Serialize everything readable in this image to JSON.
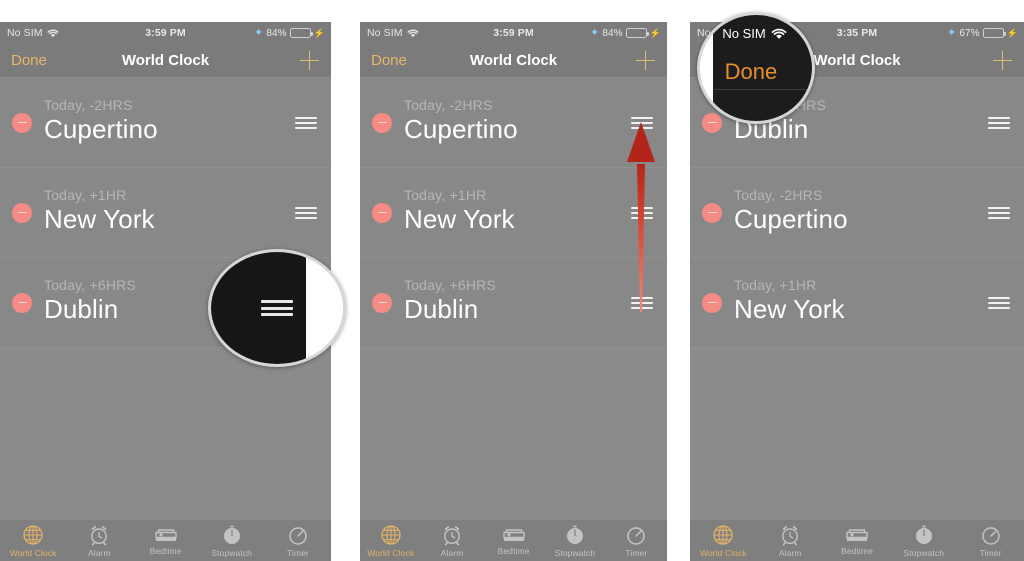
{
  "page": {
    "background": "#ffffff",
    "panel_background": "#878787",
    "accent_orange": "#e3b267",
    "delete_red": "#f58b84",
    "arrow_color": "#c0281c"
  },
  "panels": [
    {
      "id": "panel-1",
      "status_bar": {
        "carrier": "No SIM",
        "wifi_icon": "wifi-icon",
        "time": "3:59 PM",
        "bluetooth_icon": "bluetooth-icon",
        "battery_percent": "84%",
        "battery_level": 84,
        "charging_icon": "charging-bolt-icon"
      },
      "nav": {
        "done_label": "Done",
        "title": "World Clock",
        "add_icon": "plus-icon"
      },
      "rows": [
        {
          "subtitle": "Today, -2HRS",
          "city": "Cupertino",
          "delete_icon": "minus-circle-icon",
          "handle_icon": "drag-handle-icon"
        },
        {
          "subtitle": "Today, +1HR",
          "city": "New York",
          "delete_icon": "minus-circle-icon",
          "handle_icon": "drag-handle-icon"
        },
        {
          "subtitle": "Today, +6HRS",
          "city": "Dublin",
          "delete_icon": "minus-circle-icon",
          "handle_icon": "drag-handle-icon"
        }
      ],
      "tabs": [
        {
          "label": "World Clock",
          "icon": "globe-icon",
          "active": true
        },
        {
          "label": "Alarm",
          "icon": "alarm-clock-icon",
          "active": false
        },
        {
          "label": "Bedtime",
          "icon": "bed-icon",
          "active": false
        },
        {
          "label": "Stopwatch",
          "icon": "stopwatch-icon",
          "active": false
        },
        {
          "label": "Timer",
          "icon": "timer-icon",
          "active": false
        }
      ],
      "callout": {
        "type": "drag-handle-magnifier",
        "handle_icon": "drag-handle-icon"
      }
    },
    {
      "id": "panel-2",
      "status_bar": {
        "carrier": "No SIM",
        "wifi_icon": "wifi-icon",
        "time": "3:59 PM",
        "bluetooth_icon": "bluetooth-icon",
        "battery_percent": "84%",
        "battery_level": 84,
        "charging_icon": "charging-bolt-icon"
      },
      "nav": {
        "done_label": "Done",
        "title": "World Clock",
        "add_icon": "plus-icon"
      },
      "rows": [
        {
          "subtitle": "Today, -2HRS",
          "city": "Cupertino",
          "delete_icon": "minus-circle-icon",
          "handle_icon": "drag-handle-icon"
        },
        {
          "subtitle": "Today, +1HR",
          "city": "New York",
          "delete_icon": "minus-circle-icon",
          "handle_icon": "drag-handle-icon"
        },
        {
          "subtitle": "Today, +6HRS",
          "city": "Dublin",
          "delete_icon": "minus-circle-icon",
          "handle_icon": "drag-handle-icon"
        }
      ],
      "tabs": [
        {
          "label": "World Clock",
          "icon": "globe-icon",
          "active": true
        },
        {
          "label": "Alarm",
          "icon": "alarm-clock-icon",
          "active": false
        },
        {
          "label": "Bedtime",
          "icon": "bed-icon",
          "active": false
        },
        {
          "label": "Stopwatch",
          "icon": "stopwatch-icon",
          "active": false
        },
        {
          "label": "Timer",
          "icon": "timer-icon",
          "active": false
        }
      ],
      "annotation": {
        "type": "drag-up-arrow",
        "direction": "up",
        "color": "#c0281c"
      }
    },
    {
      "id": "panel-3",
      "status_bar": {
        "carrier": "No SIM",
        "wifi_icon": "wifi-icon",
        "time": "3:35 PM",
        "bluetooth_icon": "bluetooth-icon",
        "battery_percent": "67%",
        "battery_level": 67,
        "charging_icon": "charging-bolt-icon"
      },
      "nav": {
        "done_label": "Done",
        "title": "World Clock",
        "add_icon": "plus-icon"
      },
      "rows": [
        {
          "subtitle": "Today, +6HRS",
          "city": "Dublin",
          "delete_icon": "minus-circle-icon",
          "handle_icon": "drag-handle-icon"
        },
        {
          "subtitle": "Today, -2HRS",
          "city": "Cupertino",
          "delete_icon": "minus-circle-icon",
          "handle_icon": "drag-handle-icon"
        },
        {
          "subtitle": "Today, +1HR",
          "city": "New York",
          "delete_icon": "minus-circle-icon",
          "handle_icon": "drag-handle-icon"
        }
      ],
      "tabs": [
        {
          "label": "World Clock",
          "icon": "globe-icon",
          "active": true
        },
        {
          "label": "Alarm",
          "icon": "alarm-clock-icon",
          "active": false
        },
        {
          "label": "Bedtime",
          "icon": "bed-icon",
          "active": false
        },
        {
          "label": "Stopwatch",
          "icon": "stopwatch-icon",
          "active": false
        },
        {
          "label": "Timer",
          "icon": "timer-icon",
          "active": false
        }
      ],
      "callout": {
        "type": "done-button-magnifier",
        "carrier": "No SIM",
        "wifi_icon": "wifi-icon",
        "done_label": "Done"
      }
    }
  ]
}
